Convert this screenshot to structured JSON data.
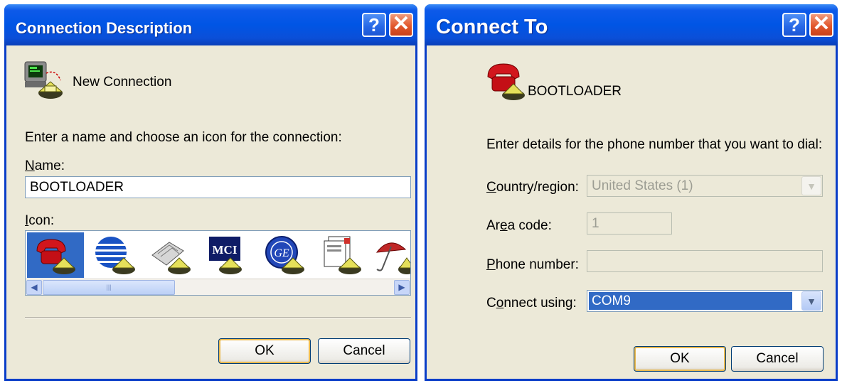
{
  "connection_description": {
    "title": "Connection Description",
    "help_glyph": "?",
    "close_glyph": "✕",
    "connection_name": "New Connection",
    "instruction": "Enter a name and choose an icon for the connection:",
    "name_label": "Name:",
    "name_value": "BOOTLOADER",
    "icon_label": "Icon:",
    "icons": [
      "red-phone-icon",
      "globe-icon",
      "fax-phone-icon",
      "mci-icon",
      "ge-icon",
      "documents-icon",
      "umbrella-icon"
    ],
    "ok_label": "OK",
    "cancel_label": "Cancel"
  },
  "connect_to": {
    "title": "Connect To",
    "help_glyph": "?",
    "close_glyph": "✕",
    "connection_name": "BOOTLOADER",
    "instruction": "Enter details for the phone number that you want to dial:",
    "country_label": "Country/region:",
    "country_value": "United States (1)",
    "area_label": "Area code:",
    "area_value": "1",
    "phone_label": "Phone number:",
    "phone_value": "",
    "connect_using_label": "Connect using:",
    "connect_using_value": "COM9",
    "ok_label": "OK",
    "cancel_label": "Cancel"
  },
  "colors": {
    "titlebar": "#0055e5",
    "dialog_bg": "#ece9d8",
    "selection": "#316ac5",
    "close_button": "#e2582c"
  }
}
